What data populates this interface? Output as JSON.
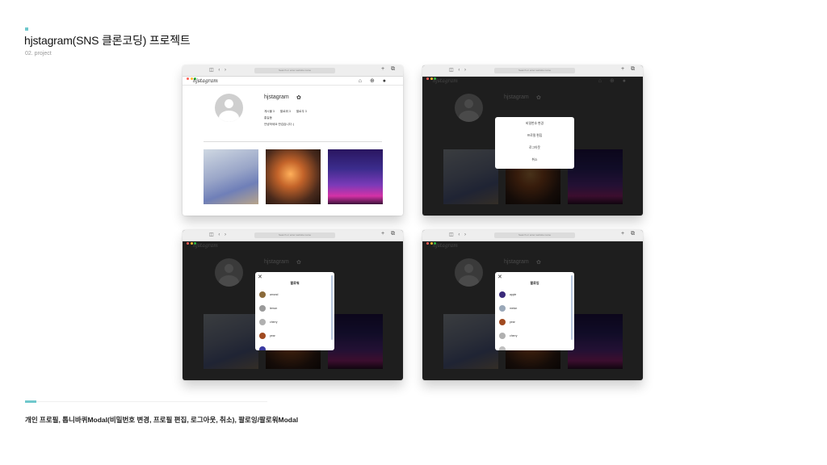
{
  "page": {
    "title": "hjstagram(SNS 클론코딩) 프로젝트",
    "subtitle": "02. project",
    "caption": "개인 프로필, 톱니바퀴Modal(비밀번호 변경, 프로필 편집, 로그아웃, 취소), 팔로잉/팔로워Modal",
    "accent_color": "#6fc8cc"
  },
  "browser": {
    "url_placeholder": "Search or enter website name",
    "traffic_lights": [
      "#ff5f57",
      "#febc2e",
      "#28c840"
    ],
    "left_icons": "◫ ‹ ›",
    "right_icons": "+ ⧉"
  },
  "profile": {
    "logo": "hjstagram",
    "nav_icons": "⌂ ⊕ ●",
    "username": "hjstagram",
    "gear_icon": "✿",
    "stats": [
      "게시물 3",
      "팔로워 3",
      "팔로우 3"
    ],
    "real_name": "홍길동",
    "bio": "안녕하세요 반갑습니다 :)",
    "photos": [
      "bedroom-photo",
      "candle-room-photo",
      "neon-room-photo"
    ]
  },
  "gear_modal": {
    "items": [
      "비밀번호 변경",
      "프로필 편집",
      "로그아웃",
      "취소"
    ]
  },
  "followers_modal": {
    "title": "팔로워",
    "close": "✕",
    "users": [
      {
        "name": "amond",
        "color": "#8a6a3a"
      },
      {
        "name": "lemon",
        "color": "#9a9a9a"
      },
      {
        "name": "cherry",
        "color": "#b0b0b0"
      },
      {
        "name": "pear",
        "color": "#a04a20"
      },
      {
        "name": "",
        "color": "#3a3aa0"
      }
    ]
  },
  "following_modal": {
    "title": "팔로잉",
    "close": "✕",
    "users": [
      {
        "name": "apple",
        "color": "#3a2a7a"
      },
      {
        "name": "melon",
        "color": "#9aa8b8"
      },
      {
        "name": "pear",
        "color": "#a04a20"
      },
      {
        "name": "cherry",
        "color": "#b0b0b0"
      },
      {
        "name": "",
        "color": "#c0c0c0"
      }
    ]
  }
}
